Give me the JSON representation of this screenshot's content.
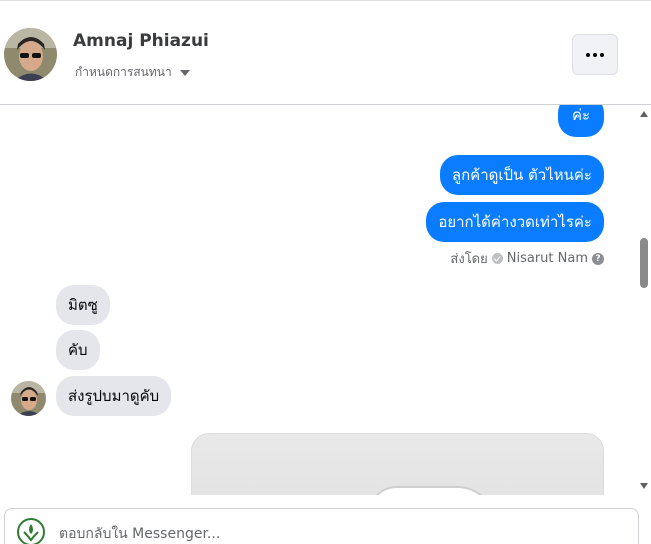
{
  "header": {
    "contact_name": "Amnaj Phiazui",
    "customize_label": "กำหนดการสนทนา",
    "more_icon": "more-dots-icon"
  },
  "messages": {
    "outgoing_partial": "ค่ะ",
    "outgoing_1": "ลูกค้าดูเป็น ตัวไหนค่ะ",
    "outgoing_2": "อยากได้ค่างวดเท่าไรค่ะ",
    "sent_by_prefix": "ส่งโดย",
    "sent_by_name": "Nisarut Nam",
    "incoming_1": "มิตซู",
    "incoming_2": "คับ",
    "incoming_3": "ส่งรูปบมาดูคับ"
  },
  "composer": {
    "placeholder": "ตอบกลับใน Messenger..."
  },
  "colors": {
    "outgoing_bubble": "#0a7cff",
    "incoming_bubble": "#e4e6eb"
  }
}
